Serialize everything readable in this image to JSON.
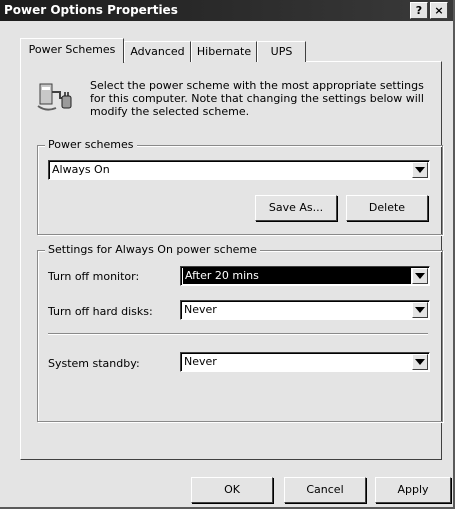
{
  "window": {
    "title": "Power Options Properties",
    "help_label": "?",
    "close_label": "×"
  },
  "tabs": [
    {
      "label": "Power Schemes",
      "active": true
    },
    {
      "label": "Advanced",
      "active": false
    },
    {
      "label": "Hibernate",
      "active": false
    },
    {
      "label": "UPS",
      "active": false
    }
  ],
  "intro": {
    "icon": "power-scheme-icon",
    "text": "Select the power scheme with the most appropriate settings for this computer. Note that changing the settings below will modify the selected scheme."
  },
  "power_schemes": {
    "label": "Power schemes",
    "selected": "Always On",
    "save_as_label": "Save As...",
    "delete_label": "Delete"
  },
  "settings": {
    "label": "Settings for Always On power scheme",
    "monitor_label": "Turn off monitor:",
    "monitor_value": "After 20 mins",
    "disks_label": "Turn off hard disks:",
    "disks_value": "Never",
    "standby_label": "System standby:",
    "standby_value": "Never"
  },
  "buttons": {
    "ok": "OK",
    "cancel": "Cancel",
    "apply": "Apply"
  },
  "colors": {
    "titlebar": "#1c1c1c",
    "face": "#e4e4e4",
    "selection": "#000000"
  }
}
